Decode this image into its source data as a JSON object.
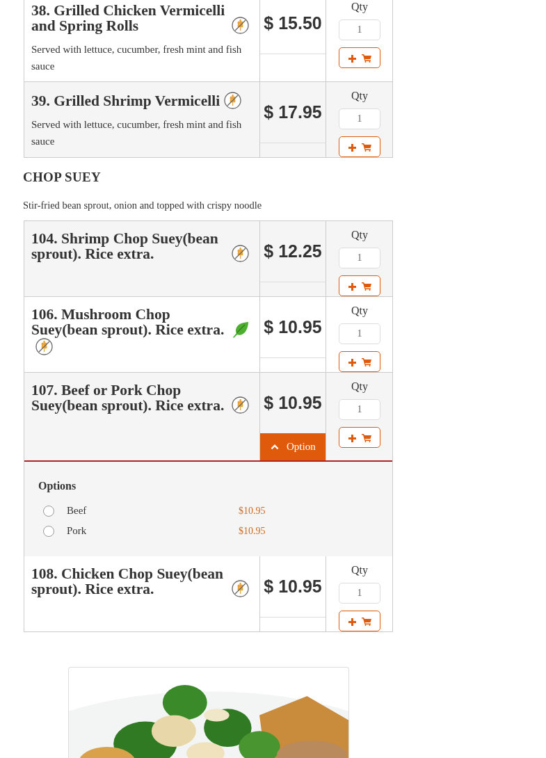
{
  "sections": [
    {
      "items": [
        {
          "name": "38. Grilled Chicken Vermicelli and Spring Rolls",
          "badges": [
            {
              "kind": "gluten_free"
            }
          ],
          "description": "Served with lettuce, cucumber, fresh mint and fish sauce",
          "price": "$ 15.50",
          "qty_label": "Qty",
          "qty": "1"
        },
        {
          "name": "39. Grilled Shrimp Vermicelli",
          "badges": [
            {
              "kind": "gluten_free"
            }
          ],
          "description": "Served with lettuce, cucumber, fresh mint and fish sauce",
          "price": "$ 17.95",
          "qty_label": "Qty",
          "qty": "1"
        }
      ]
    },
    {
      "title": "CHOP SUEY",
      "description": "Stir-fried bean sprout, onion and topped with crispy noodle",
      "items": [
        {
          "name": "104. Shrimp Chop Suey(bean sprout). Rice extra.",
          "badges": [
            {
              "kind": "gluten_free"
            }
          ],
          "price": "$ 12.25",
          "qty_label": "Qty",
          "qty": "1"
        },
        {
          "name": "106. Mushroom Chop Suey(bean sprout). Rice extra.",
          "badges": [
            {
              "kind": "vegetarian"
            },
            {
              "kind": "gluten_free"
            }
          ],
          "price": "$ 10.95",
          "qty_label": "Qty",
          "qty": "1"
        },
        {
          "name": "107. Beef or Pork Chop Suey(bean sprout). Rice extra.",
          "badges": [
            {
              "kind": "gluten_free"
            }
          ],
          "price": "$ 10.95",
          "qty_label": "Qty",
          "qty": "1",
          "option_button": {
            "label": "Option",
            "expanded": true
          },
          "options": {
            "title": "Options",
            "choices": [
              {
                "label": "Beef",
                "price": "$10.95",
                "selected": false
              },
              {
                "label": "Pork",
                "price": "$10.95",
                "selected": false
              }
            ]
          }
        },
        {
          "name": "108. Chicken Chop Suey(bean sprout). Rice extra.",
          "badges": [
            {
              "kind": "gluten_free"
            }
          ],
          "price": "$ 10.95",
          "qty_label": "Qty",
          "qty": "1"
        }
      ]
    }
  ]
}
